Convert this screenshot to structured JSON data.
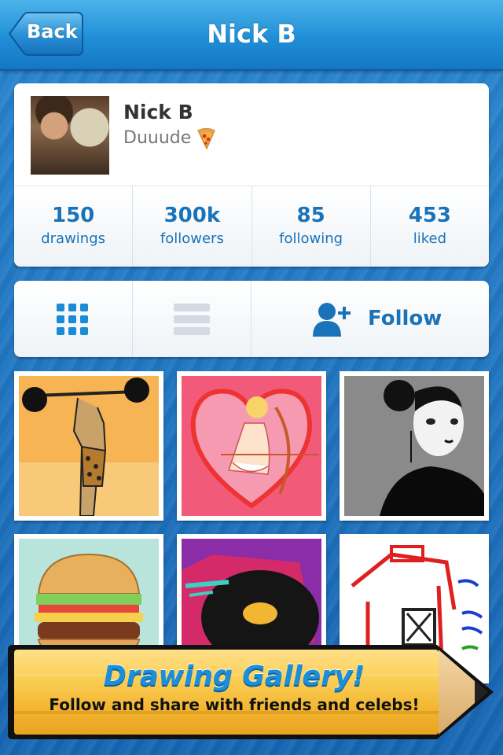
{
  "nav": {
    "back_label": "Back",
    "title": "Nick B"
  },
  "profile": {
    "name": "Nick B",
    "status": "Duuude",
    "status_icon": "pizza-icon",
    "stats": [
      {
        "value": "150",
        "label": "drawings"
      },
      {
        "value": "300k",
        "label": "followers"
      },
      {
        "value": "85",
        "label": "following"
      },
      {
        "value": "453",
        "label": "liked"
      }
    ]
  },
  "toolbar": {
    "grid_icon": "grid-view-icon",
    "list_icon": "list-view-icon",
    "follow_icon": "add-person-icon",
    "follow_label": "Follow"
  },
  "gallery": {
    "items": [
      {
        "subject": "strongman-lifting-barbell"
      },
      {
        "subject": "cupid-with-heart"
      },
      {
        "subject": "woman-portrait-black-white"
      },
      {
        "subject": "hamburger"
      },
      {
        "subject": "vinyl-record-turntable"
      },
      {
        "subject": "red-barn"
      }
    ]
  },
  "banner": {
    "title": "Drawing Gallery!",
    "subtitle": "Follow and share with friends and celebs!"
  },
  "colors": {
    "accent": "#1a72b9",
    "navbar": "#1f8fd6",
    "background": "#1d6fb8",
    "banner": "#f6c23e"
  }
}
